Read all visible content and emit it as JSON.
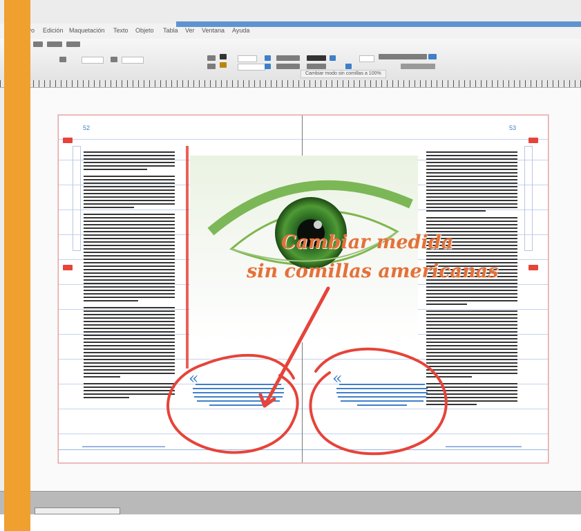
{
  "menu": {
    "items": [
      "Archivo",
      "Edición",
      "Maquetación",
      "Texto",
      "Objeto",
      "Tabla",
      "Ver",
      "Ventana",
      "Ayuda"
    ]
  },
  "toolbar": {
    "document_tab": "Cambiar modo sin comillas a 100%"
  },
  "spread": {
    "left_page_number": "52",
    "right_page_number": "53"
  },
  "headline": {
    "line1": "Cambiar medida",
    "line2": "sin comillas americanas"
  },
  "quote": {
    "mark": "«"
  },
  "colors": {
    "accent_orange": "#f0a02f",
    "annotation_red": "#e6443a",
    "headline_orange": "#e3713a",
    "link_blue": "#3f7fc9"
  },
  "icons": {
    "quote_mark": "left-guillemet-icon"
  }
}
